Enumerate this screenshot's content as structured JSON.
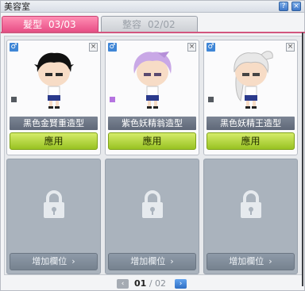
{
  "window": {
    "title": "美容室",
    "help_icon": "?",
    "close_icon": "×"
  },
  "tabs": [
    {
      "label": "髮型",
      "count": "03/03"
    },
    {
      "label": "整容",
      "count": "02/02"
    }
  ],
  "cards": [
    {
      "gender": "♂",
      "close": "×",
      "name": "黑色金賢重造型",
      "button": "應用",
      "hair_color": "#111111",
      "swatch": "#555a60"
    },
    {
      "gender": "♂",
      "close": "×",
      "name": "紫色妖精翁造型",
      "button": "應用",
      "hair_color": "#c9a8e6",
      "swatch": "#b574e0"
    },
    {
      "gender": "♂",
      "close": "×",
      "name": "黑色妖精王造型",
      "button": "應用",
      "hair_color": "#e8e8e8",
      "swatch": "#555a60"
    }
  ],
  "slots": [
    {
      "button": "增加欄位",
      "chevron": "›"
    },
    {
      "button": "增加欄位",
      "chevron": "›"
    },
    {
      "button": "增加欄位",
      "chevron": "›"
    }
  ],
  "pager": {
    "current": "01",
    "separator": "/",
    "total": "02",
    "prev": "‹",
    "next": "›"
  }
}
